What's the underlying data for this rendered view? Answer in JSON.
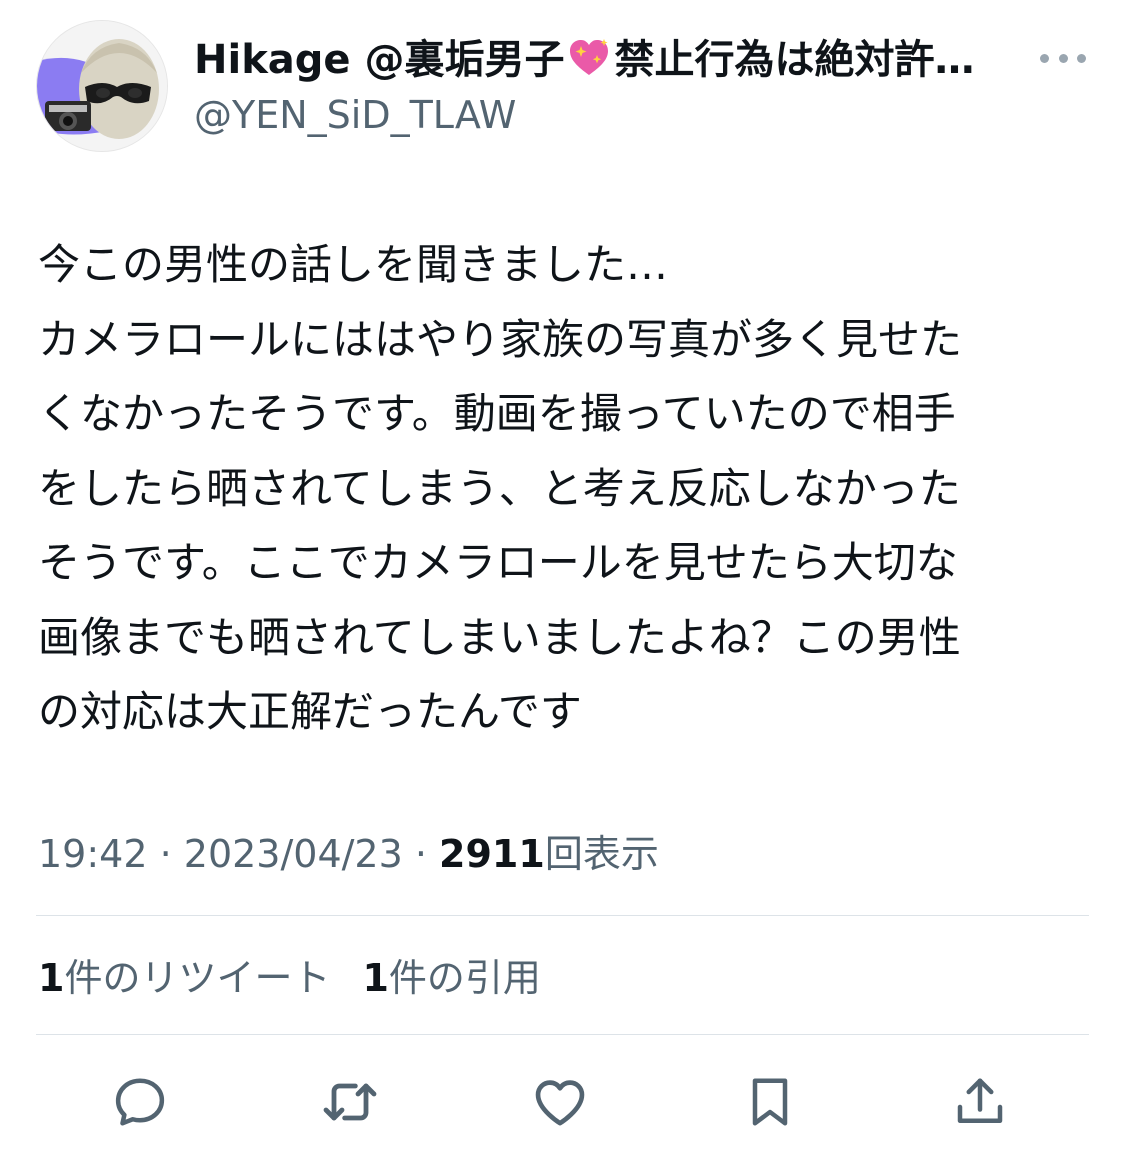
{
  "author": {
    "name_prefix": "Hikage @裏垢男子",
    "name_suffix": "禁止行為は絶対許…",
    "handle": "@YEN_SiD_TLAW"
  },
  "tweet": {
    "text": "今この男性の話しを聞きました…\nカメラロールにははやり家族の写真が多く見せた\nくなかったそうです。動画を撮っていたので相手\nをしたら晒されてしまう、と考え反応しなかった\nそうです。ここでカメラロールを見せたら大切な\n画像までも晒されてしまいましたよね？この男性\nの対応は大正解だったんです",
    "time": "19:42",
    "separator": " · ",
    "date": "2023/04/23",
    "views_count": "2911",
    "views_label": "回表示"
  },
  "stats": {
    "retweets_count": "1",
    "retweets_label": "件のリツイート",
    "quotes_count": "1",
    "quotes_label": "件の引用"
  },
  "icons": {
    "reply": "reply-icon",
    "retweet": "retweet-icon",
    "like": "like-icon",
    "bookmark": "bookmark-icon",
    "share": "share-icon",
    "more": "more-icon",
    "name_emoji": "sparkling-heart-icon"
  },
  "colors": {
    "text": "#0f1419",
    "secondary": "#536471",
    "divider": "#dde3e8",
    "icon": "#536471"
  }
}
